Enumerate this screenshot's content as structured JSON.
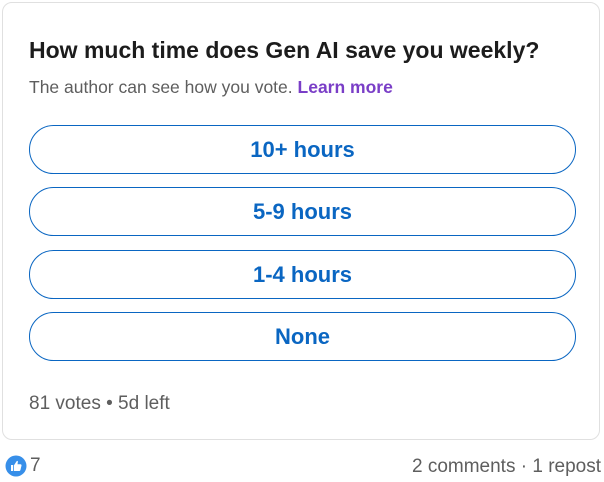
{
  "poll": {
    "question": "How much time does Gen AI save you weekly?",
    "note": "The author can see how you vote.",
    "learn_more": "Learn more",
    "options": [
      {
        "label": "10+ hours"
      },
      {
        "label": "5-9 hours"
      },
      {
        "label": "1-4 hours"
      },
      {
        "label": "None"
      }
    ],
    "votes": "81 votes",
    "separator": "•",
    "time_left": "5d left"
  },
  "footer": {
    "reaction_icon": "like-icon",
    "reaction_count": "7",
    "comments": "2 comments",
    "dot": "·",
    "reposts": "1 repost"
  },
  "colors": {
    "accent": "#0a66c2",
    "learn_more": "#7a3ec7",
    "text_primary": "#1c1c1c",
    "text_secondary": "#5e5e5e"
  }
}
